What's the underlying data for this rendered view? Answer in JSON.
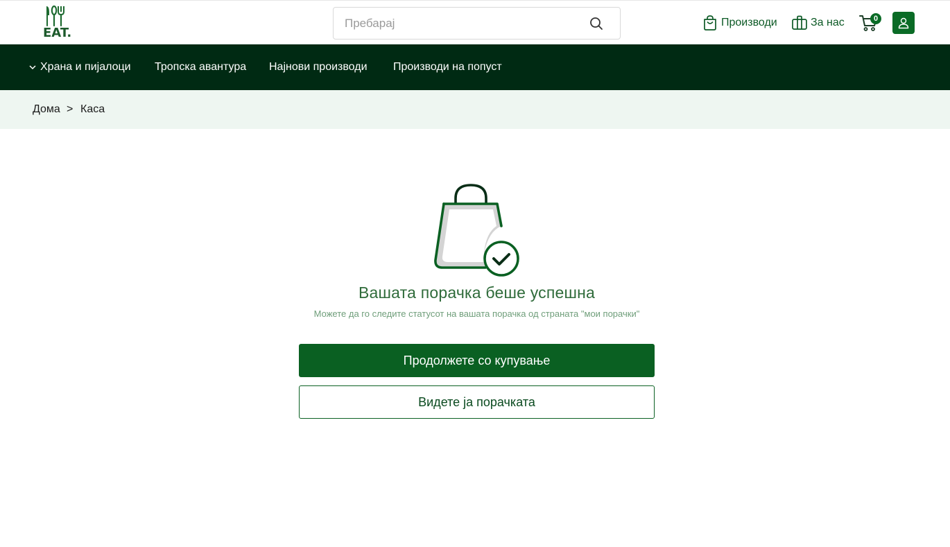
{
  "header": {
    "logo_text": "EAT.",
    "search": {
      "placeholder": "Пребарај"
    },
    "links": [
      {
        "label": "Производи",
        "icon": "shopping-bag-icon"
      },
      {
        "label": "За нас",
        "icon": "gift-icon"
      }
    ],
    "cart": {
      "count": "0",
      "icon": "cart-icon"
    },
    "user": {
      "icon": "user-icon"
    }
  },
  "menu": {
    "items": [
      {
        "label": "Храна и пијалоци",
        "has_dropdown": true
      },
      {
        "label": "Тропска авантура"
      },
      {
        "label": "Најнови производи"
      },
      {
        "label": "Производи на попуст"
      }
    ]
  },
  "breadcrumb": {
    "items": [
      "Дома",
      "Каса"
    ],
    "separator": ">"
  },
  "confirmation": {
    "icon": "shopping-bag-check-icon",
    "title": "Вашата порачка беше успешна",
    "subtitle": "Можете да го следите статусот на вашата порачка од страната \"мои порачки\"",
    "primary_button": "Продолжете со купување",
    "secondary_button": "Видете ја порачката"
  },
  "colors": {
    "brand_green": "#0a6022",
    "menu_bg": "#002a13",
    "breadcrumb_bg": "#eef6f1"
  }
}
